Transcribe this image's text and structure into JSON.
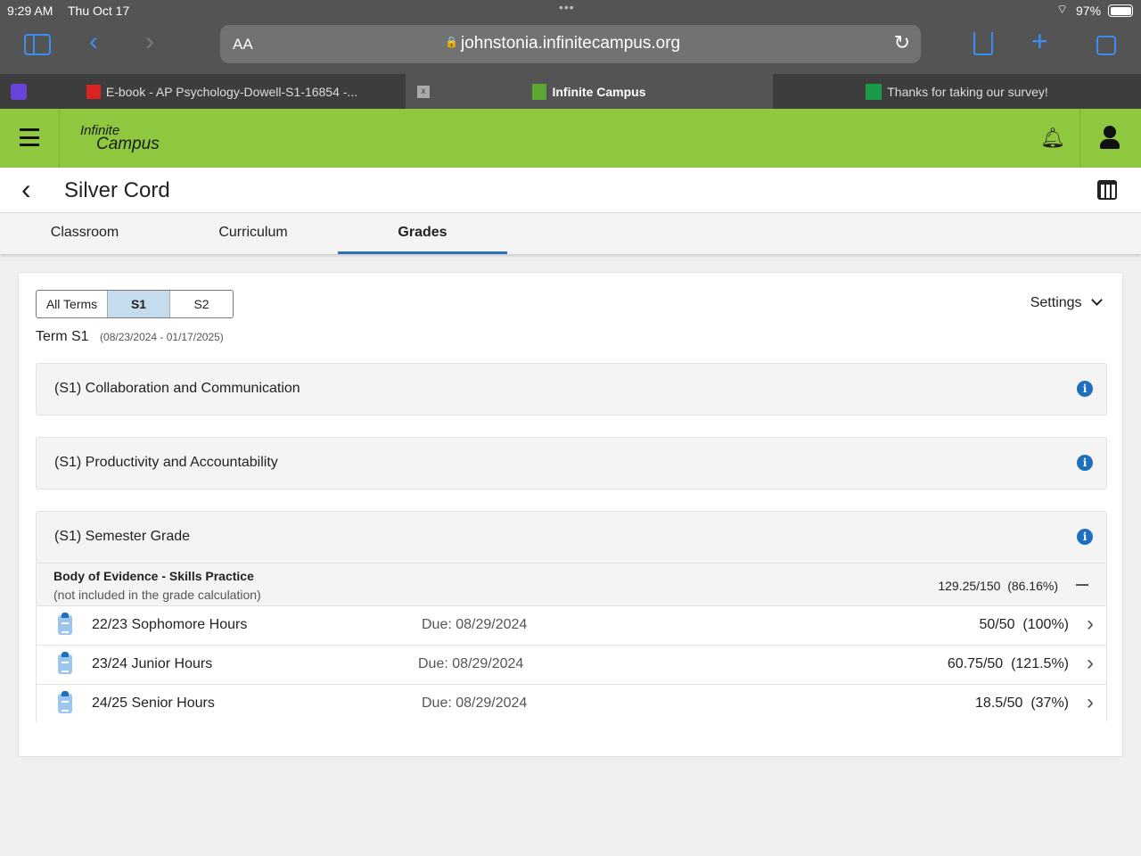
{
  "status": {
    "time": "9:29 AM",
    "date": "Thu Oct 17",
    "battery": "97%"
  },
  "browser": {
    "text_size": "AA",
    "url": "johnstonia.infinitecampus.org"
  },
  "tabs": [
    {
      "label": "E-book - AP Psychology-Dowell-S1-16854 -..."
    },
    {
      "label": "Infinite Campus"
    },
    {
      "label": "Thanks for taking our survey!"
    }
  ],
  "header": {
    "logo_top": "Infinite",
    "logo_bottom": "Campus"
  },
  "page": {
    "title": "Silver Cord"
  },
  "nav": [
    {
      "label": "Classroom"
    },
    {
      "label": "Curriculum"
    },
    {
      "label": "Grades"
    }
  ],
  "terms": {
    "options": [
      "All Terms",
      "S1",
      "S2"
    ],
    "selected": "S1",
    "term_label": "Term S1",
    "term_dates": "(08/23/2024 - 01/17/2025)",
    "settings": "Settings"
  },
  "panels": [
    {
      "title": "(S1) Collaboration and Communication"
    },
    {
      "title": "(S1) Productivity and Accountability"
    },
    {
      "title": "(S1) Semester Grade"
    }
  ],
  "category": {
    "name": "Body of Evidence - Skills Practice",
    "note": "(not included in the grade calculation)",
    "score": "129.25/150",
    "percent": "(86.16%)"
  },
  "assignments": [
    {
      "name": "22/23 Sophomore Hours",
      "due": "Due: 08/29/2024",
      "score": "50/50",
      "percent": "(100%)"
    },
    {
      "name": "23/24 Junior Hours",
      "due": "Due: 08/29/2024",
      "score": "60.75/50",
      "percent": "(121.5%)"
    },
    {
      "name": "24/25 Senior Hours",
      "due": "Due: 08/29/2024",
      "score": "18.5/50",
      "percent": "(37%)"
    }
  ]
}
